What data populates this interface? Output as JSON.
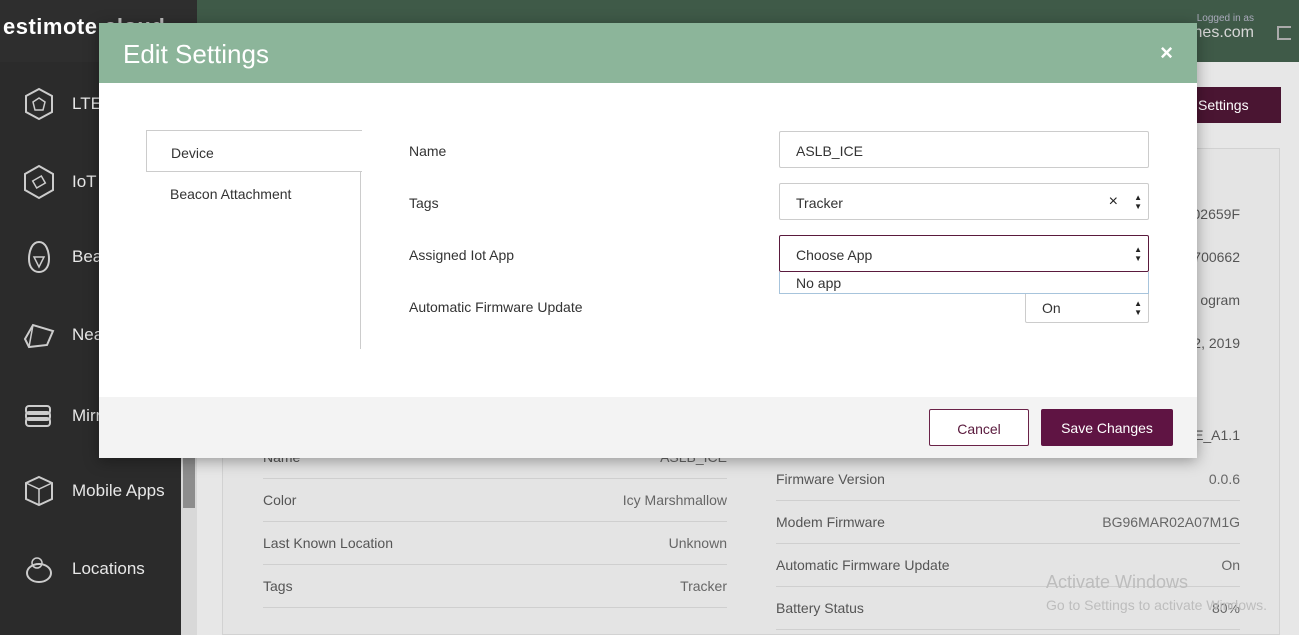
{
  "app": {
    "logo": "estimote",
    "logo_suffix": " cloud"
  },
  "sidebar": {
    "items": [
      {
        "label": "LTE",
        "icon": "lte-beacon-icon"
      },
      {
        "label": "IoT",
        "icon": "iot-satellite-icon"
      },
      {
        "label": "Beac",
        "icon": "beacon-icon"
      },
      {
        "label": "Nea",
        "icon": "nearable-icon"
      },
      {
        "label": "Mirr",
        "icon": "mirror-icon"
      },
      {
        "label": "Mobile Apps",
        "icon": "box-icon"
      },
      {
        "label": "Locations",
        "icon": "location-icon"
      }
    ]
  },
  "topbar": {
    "logged_in_label": "Logged in as",
    "user_fragment": "hes.com"
  },
  "background": {
    "settings_button": "Settings",
    "left_rows": [
      {
        "label": "Name",
        "value": "ASLB_ICE"
      },
      {
        "label": "Color",
        "value": "Icy Marshmallow"
      },
      {
        "label": "Last Known Location",
        "value": "Unknown"
      },
      {
        "label": "Tags",
        "value": "Tracker"
      }
    ],
    "right_fragments": [
      "02659F",
      "700662",
      "ogram",
      "2, 2019",
      "E_A1.1"
    ],
    "right_rows": [
      {
        "label": "Firmware Version",
        "value": "0.0.6"
      },
      {
        "label": "Modem Firmware",
        "value": "BG96MAR02A07M1G"
      },
      {
        "label": "Automatic Firmware Update",
        "value": "On"
      },
      {
        "label": "Battery Status",
        "value": "80%"
      }
    ]
  },
  "modal": {
    "title": "Edit Settings",
    "close_glyph": "×",
    "tabs": [
      "Device",
      "Beacon Attachment"
    ],
    "fields": {
      "name_label": "Name",
      "name_value": "ASLB_ICE",
      "tags_label": "Tags",
      "tags_value": "Tracker",
      "app_label": "Assigned Iot App",
      "app_value": "Choose App",
      "app_option": "No app",
      "firmware_label": "Automatic Firmware Update",
      "firmware_value": "On"
    },
    "cancel": "Cancel",
    "save": "Save Changes"
  },
  "watermark": {
    "line1": "Activate Windows",
    "line2": "Go to Settings to activate Windows."
  }
}
